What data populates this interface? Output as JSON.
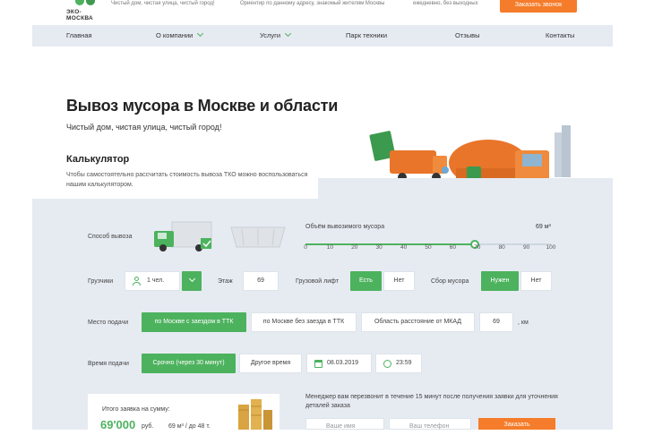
{
  "header": {
    "logo_text": "ЭКО-МОСКВА",
    "tagline": "Чистый дом, чистая улица, чистый город!",
    "info_1": "Ориентир по данному адресу, знакомый жителям Москвы",
    "info_2": "ежедневно, без выходных",
    "call_button": "Заказать звонок",
    "accent_color": "#f57c2a",
    "brand_color": "#4db25e"
  },
  "nav": {
    "items": [
      "Главная",
      "О компании",
      "Услуги",
      "Парк техники",
      "Отзывы",
      "Контакты"
    ]
  },
  "hero": {
    "title": "Вывоз мусора в Москве и области",
    "subtitle": "Чистый дом, чистая улица, чистый город!"
  },
  "calculator": {
    "title": "Калькулятор",
    "description": "Чтобы самостоятельно рассчитать стоимость вывоза ТКО можно воспользоваться нашим калькулятором.",
    "method_label": "Способ вывоза",
    "volume_label": "Объём вывозимого мусора",
    "volume_value": "69 м³",
    "volume_level": 69,
    "volume_ticks": [
      "0",
      "10",
      "20",
      "30",
      "40",
      "50",
      "60",
      "70",
      "80",
      "90",
      "100"
    ],
    "loaders_label": "Грузчики",
    "loaders_value": "1 чел.",
    "floor_label": "Этаж",
    "floor_value": "69",
    "lift_label": "Грузовой лифт",
    "lift_yes": "Есть",
    "lift_no": "Нет",
    "collect_label": "Сбор мусора",
    "collect_yes": "Нужен",
    "collect_no": "Нет",
    "place_label": "Место подачи",
    "place_opt1": "по Москве с заездом в ТТК",
    "place_opt2": "по Москве без заезда в ТТК",
    "place_opt3": "Область расстояние от МКАД",
    "distance_value": "69",
    "distance_unit": ", км",
    "time_label": "Время подачи",
    "time_opt1": "Срочно (через 30 минут)",
    "time_opt2": "Другое время",
    "date_value": "08.03.2019",
    "time_value": "23:59"
  },
  "summary": {
    "label": "Итого заявка на сумму:",
    "amount": "69'000",
    "currency": "руб.",
    "details": "69 м³ / до 48 т."
  },
  "contact": {
    "note": "Менеджер вам перезвонит в течение 15 минут после получения заявки для уточнения деталей заказа",
    "name_placeholder": "Ваше имя",
    "phone_placeholder": "Ваш телефон",
    "order_button": "Заказать"
  }
}
